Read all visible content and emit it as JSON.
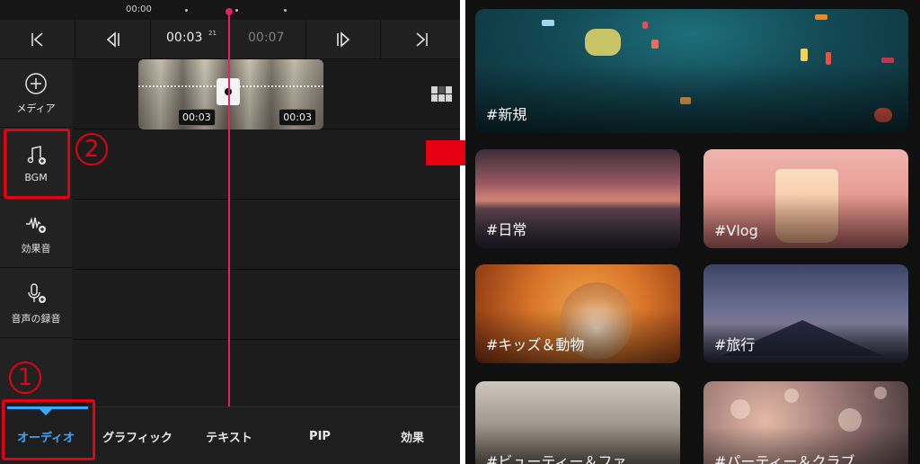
{
  "editor": {
    "ruler": {
      "time_label": "00:00"
    },
    "transport": {
      "current_time": "00:03",
      "current_frames": "21",
      "total_time": "00:07"
    },
    "clip": {
      "duration_left": "00:03",
      "duration_right": "00:03"
    },
    "sidebar": {
      "items": [
        {
          "label": "メディア",
          "icon": "plus-circle-icon"
        },
        {
          "label": "BGM",
          "icon": "music-note-add-icon"
        },
        {
          "label": "効果音",
          "icon": "waveform-add-icon"
        },
        {
          "label": "音声の録音",
          "icon": "microphone-add-icon"
        }
      ]
    },
    "bottom_tabs": [
      {
        "label": "オーディオ",
        "active": true
      },
      {
        "label": "グラフィック",
        "active": false
      },
      {
        "label": "テキスト",
        "active": false
      },
      {
        "label": "PIP",
        "active": false
      },
      {
        "label": "効果",
        "active": false
      }
    ],
    "accent_color": "#3aa8ff",
    "playhead_color": "#e0245e"
  },
  "callouts": {
    "step1": "1",
    "step2": "2",
    "color": "#e60012"
  },
  "library": {
    "categories": [
      {
        "label": "#新規"
      },
      {
        "label": "#日常"
      },
      {
        "label": "#Vlog"
      },
      {
        "label": "#キッズ＆動物"
      },
      {
        "label": "#旅行"
      },
      {
        "label": "#ビューティー＆ファ…"
      },
      {
        "label": "#パーティー＆クラブ"
      }
    ]
  }
}
